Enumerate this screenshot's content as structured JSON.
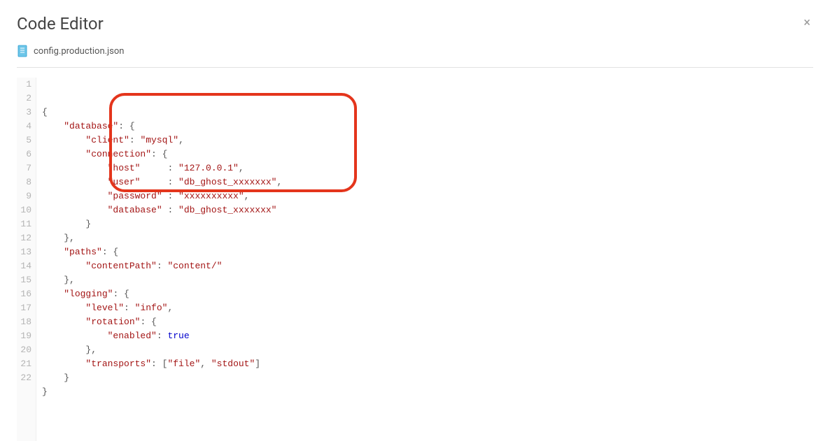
{
  "header": {
    "title": "Code Editor",
    "close_label": "×"
  },
  "file": {
    "name": "config.production.json"
  },
  "code": {
    "lines": [
      {
        "n": 1,
        "tokens": [
          {
            "t": "{",
            "c": "punc"
          }
        ]
      },
      {
        "n": 2,
        "tokens": [
          {
            "t": "    ",
            "c": ""
          },
          {
            "t": "\"database\"",
            "c": "key"
          },
          {
            "t": ": {",
            "c": "punc"
          }
        ]
      },
      {
        "n": 3,
        "tokens": [
          {
            "t": "        ",
            "c": ""
          },
          {
            "t": "\"client\"",
            "c": "key"
          },
          {
            "t": ": ",
            "c": "punc"
          },
          {
            "t": "\"mysql\"",
            "c": "str"
          },
          {
            "t": ",",
            "c": "punc"
          }
        ]
      },
      {
        "n": 4,
        "tokens": [
          {
            "t": "        ",
            "c": ""
          },
          {
            "t": "\"connection\"",
            "c": "key"
          },
          {
            "t": ": {",
            "c": "punc"
          }
        ]
      },
      {
        "n": 5,
        "tokens": [
          {
            "t": "            ",
            "c": ""
          },
          {
            "t": "\"host\"",
            "c": "key"
          },
          {
            "t": "     : ",
            "c": "punc"
          },
          {
            "t": "\"127.0.0.1\"",
            "c": "str"
          },
          {
            "t": ",",
            "c": "punc"
          }
        ]
      },
      {
        "n": 6,
        "tokens": [
          {
            "t": "            ",
            "c": ""
          },
          {
            "t": "\"user\"",
            "c": "key"
          },
          {
            "t": "     : ",
            "c": "punc"
          },
          {
            "t": "\"db_ghost_xxxxxxx\"",
            "c": "str"
          },
          {
            "t": ",",
            "c": "punc"
          }
        ]
      },
      {
        "n": 7,
        "tokens": [
          {
            "t": "            ",
            "c": ""
          },
          {
            "t": "\"password\"",
            "c": "key"
          },
          {
            "t": " : ",
            "c": "punc"
          },
          {
            "t": "\"xxxxxxxxxx\"",
            "c": "str"
          },
          {
            "t": ",",
            "c": "punc"
          }
        ]
      },
      {
        "n": 8,
        "tokens": [
          {
            "t": "            ",
            "c": ""
          },
          {
            "t": "\"database\"",
            "c": "key"
          },
          {
            "t": " : ",
            "c": "punc"
          },
          {
            "t": "\"db_ghost_xxxxxxx\"",
            "c": "str"
          }
        ]
      },
      {
        "n": 9,
        "tokens": [
          {
            "t": "        }",
            "c": "punc"
          }
        ]
      },
      {
        "n": 10,
        "tokens": [
          {
            "t": "    },",
            "c": "punc"
          }
        ]
      },
      {
        "n": 11,
        "tokens": [
          {
            "t": "    ",
            "c": ""
          },
          {
            "t": "\"paths\"",
            "c": "key"
          },
          {
            "t": ": {",
            "c": "punc"
          }
        ]
      },
      {
        "n": 12,
        "tokens": [
          {
            "t": "        ",
            "c": ""
          },
          {
            "t": "\"contentPath\"",
            "c": "key"
          },
          {
            "t": ": ",
            "c": "punc"
          },
          {
            "t": "\"content/\"",
            "c": "str"
          }
        ]
      },
      {
        "n": 13,
        "tokens": [
          {
            "t": "    },",
            "c": "punc"
          }
        ]
      },
      {
        "n": 14,
        "tokens": [
          {
            "t": "    ",
            "c": ""
          },
          {
            "t": "\"logging\"",
            "c": "key"
          },
          {
            "t": ": {",
            "c": "punc"
          }
        ]
      },
      {
        "n": 15,
        "tokens": [
          {
            "t": "        ",
            "c": ""
          },
          {
            "t": "\"level\"",
            "c": "key"
          },
          {
            "t": ": ",
            "c": "punc"
          },
          {
            "t": "\"info\"",
            "c": "str"
          },
          {
            "t": ",",
            "c": "punc"
          }
        ]
      },
      {
        "n": 16,
        "tokens": [
          {
            "t": "        ",
            "c": ""
          },
          {
            "t": "\"rotation\"",
            "c": "key"
          },
          {
            "t": ": {",
            "c": "punc"
          }
        ]
      },
      {
        "n": 17,
        "tokens": [
          {
            "t": "            ",
            "c": ""
          },
          {
            "t": "\"enabled\"",
            "c": "key"
          },
          {
            "t": ": ",
            "c": "punc"
          },
          {
            "t": "true",
            "c": "bool"
          }
        ]
      },
      {
        "n": 18,
        "tokens": [
          {
            "t": "        },",
            "c": "punc"
          }
        ]
      },
      {
        "n": 19,
        "tokens": [
          {
            "t": "        ",
            "c": ""
          },
          {
            "t": "\"transports\"",
            "c": "key"
          },
          {
            "t": ": [",
            "c": "punc"
          },
          {
            "t": "\"file\"",
            "c": "str"
          },
          {
            "t": ", ",
            "c": "punc"
          },
          {
            "t": "\"stdout\"",
            "c": "str"
          },
          {
            "t": "]",
            "c": "punc"
          }
        ]
      },
      {
        "n": 20,
        "tokens": [
          {
            "t": "    }",
            "c": "punc"
          }
        ]
      },
      {
        "n": 21,
        "tokens": [
          {
            "t": "}",
            "c": "punc"
          }
        ]
      },
      {
        "n": 22,
        "tokens": []
      }
    ]
  }
}
